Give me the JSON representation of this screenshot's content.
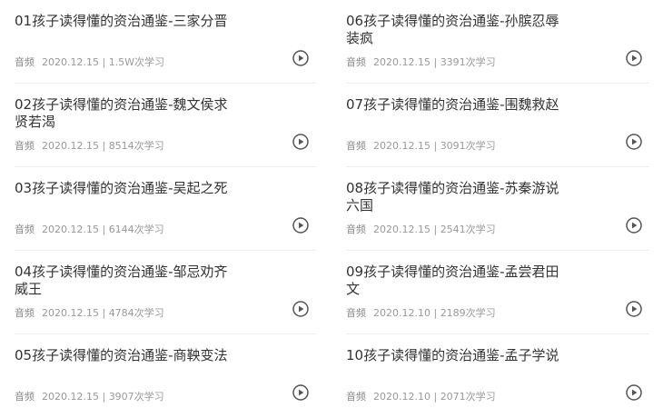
{
  "episodes": [
    {
      "title": "01孩子读得懂的资治通鉴-三家分晋",
      "type": "音频",
      "date": "2020.12.15",
      "plays": "1.5W次学习"
    },
    {
      "title": "02孩子读得懂的资治通鉴-魏文侯求贤若渴",
      "type": "音频",
      "date": "2020.12.15",
      "plays": "8514次学习"
    },
    {
      "title": "03孩子读得懂的资治通鉴-吴起之死",
      "type": "音频",
      "date": "2020.12.15",
      "plays": "6144次学习"
    },
    {
      "title": "04孩子读得懂的资治通鉴-邹忌劝齐威王",
      "type": "音频",
      "date": "2020.12.15",
      "plays": "4784次学习"
    },
    {
      "title": "05孩子读得懂的资治通鉴-商鞅变法",
      "type": "音频",
      "date": "2020.12.15",
      "plays": "3907次学习"
    },
    {
      "title": "06孩子读得懂的资治通鉴-孙膑忍辱装疯",
      "type": "音频",
      "date": "2020.12.15",
      "plays": "3391次学习"
    },
    {
      "title": "07孩子读得懂的资治通鉴-围魏救赵",
      "type": "音频",
      "date": "2020.12.15",
      "plays": "3091次学习"
    },
    {
      "title": "08孩子读得懂的资治通鉴-苏秦游说六国",
      "type": "音频",
      "date": "2020.12.15",
      "plays": "2541次学习"
    },
    {
      "title": "09孩子读得懂的资治通鉴-孟尝君田文",
      "type": "音频",
      "date": "2020.12.10",
      "plays": "2189次学习"
    },
    {
      "title": "10孩子读得懂的资治通鉴-孟子学说",
      "type": "音频",
      "date": "2020.12.10",
      "plays": "2071次学习"
    }
  ],
  "icons": {
    "play": "play-circle-icon"
  },
  "colors": {
    "title": "#333333",
    "meta": "#999999",
    "icon": "#555555",
    "divider": "#eeeeee"
  }
}
